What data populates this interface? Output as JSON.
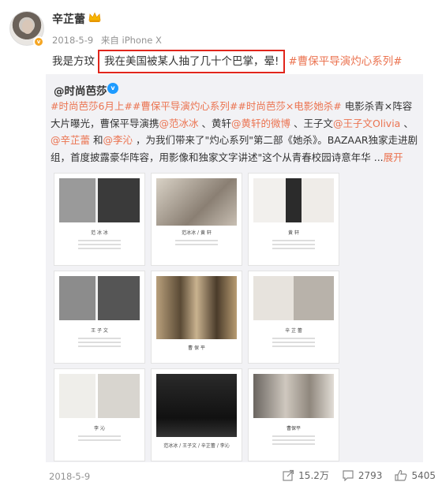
{
  "user": {
    "name": "辛芷蕾",
    "date": "2018-5-9",
    "source": "来自 iPhone X",
    "verified_badge": "v"
  },
  "post": {
    "text_before": "我是方玟",
    "text_highlight": "我在美国被某人抽了几十个巴掌，晕!",
    "hashtag": "#曹保平导演灼心系列#"
  },
  "repost": {
    "author": "@时尚芭莎",
    "author_badge": "v",
    "text": {
      "tags": "#时尚芭莎6月上##曹保平导演灼心系列##时尚芭莎×电影她杀#",
      "t1": " 电影杀青×阵容大片曝光，曹保平导演携",
      "m1": "@范冰冰",
      "t2": " 、黄轩",
      "m2": "@黄轩的微博",
      "t3": " 、王子文",
      "m3": "@王子文Olivia",
      "t4": " 、",
      "m4": "@辛芷蕾",
      "t5": " 和",
      "m5": "@李沁",
      "t6": " ，为我们带来了\"灼心系列\"第二部《她杀》。BAZAAR独家走进剧组，首度披露豪华阵容，用影像和独家文字讲述\"这个从青春校园诗意年华 ...",
      "expand": "展开"
    },
    "images": [
      {
        "caption": "范 冰 冰"
      },
      {
        "caption": "范冰冰 / 黄 轩"
      },
      {
        "caption": "黄 轩"
      },
      {
        "caption": "王 子 文"
      },
      {
        "caption": "曹 保 平"
      },
      {
        "caption": "辛 芷 蕾"
      },
      {
        "caption": "李 沁"
      },
      {
        "caption": "范冰冰 / 王子文 / 辛芷蕾 / 李沁"
      },
      {
        "caption": "曹保平"
      }
    ]
  },
  "footer": {
    "date": "2018-5-9",
    "repost_count": "15.2万",
    "comment_count": "2793",
    "like_count": "5405"
  },
  "colors": {
    "link": "#eb7350",
    "highlight_border": "#e1251b",
    "repost_bg": "#f2f2f5"
  }
}
